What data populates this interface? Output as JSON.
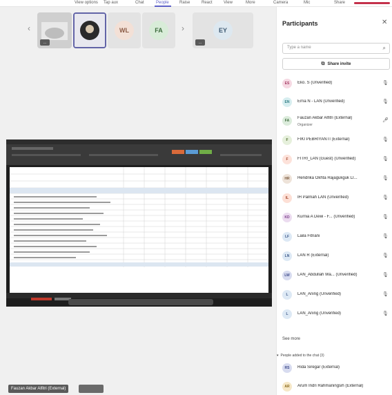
{
  "toolbar": {
    "items": [
      "View options",
      "Tap aux",
      "Chat",
      "People",
      "Raise",
      "React",
      "View",
      "More",
      "Camera",
      "Mic",
      "Share"
    ],
    "active_index": 3
  },
  "gallery": {
    "tiles": [
      {
        "initials": "",
        "type": "photo-room",
        "badge": "…"
      },
      {
        "initials": "",
        "type": "photo-face",
        "selected": true
      },
      {
        "initials": "WL",
        "color": "#f3e0d6",
        "text_color": "#8a5a44"
      },
      {
        "initials": "FA",
        "color": "#d8ecd8",
        "text_color": "#3d6b3d"
      },
      {
        "initials": "EY",
        "color": "#dde8f0",
        "text_color": "#3e5a73",
        "badge": "…"
      }
    ]
  },
  "stage": {
    "presenter_name": "Fauzan Akbar Alfitri (External)"
  },
  "panel": {
    "title": "Participants",
    "search_placeholder": "Type a name",
    "share_invite_label": "Share invite",
    "participants": [
      {
        "initials": "ES",
        "name": "Eko. S (Unverified)",
        "color": "#f6d9e3",
        "text_color": "#a33b63"
      },
      {
        "initials": "EN",
        "name": "Erna N - LAN (Unverified)",
        "color": "#d7eef0",
        "text_color": "#2d7a82"
      },
      {
        "initials": "FA",
        "name": "Fauzan Akbar Alfitri (External)",
        "role": "Organizer",
        "color": "#dcecdc",
        "text_color": "#3d6b3d",
        "mic_on": true
      },
      {
        "initials": "F",
        "name": "FIKI PEBRIYANTI (External)",
        "color": "#e6f0dc",
        "text_color": "#4f6b2d"
      },
      {
        "initials": "F",
        "name": "FITRI_LAN (Guest) (Unverified)",
        "color": "#fde2da",
        "text_color": "#a3462d"
      },
      {
        "initials": "HR",
        "name": "Hendrika Okhta Rajagukguk LI...",
        "color": "#eee3d9",
        "text_color": "#7a5a3d"
      },
      {
        "initials": "IL",
        "name": "IH Palmah LAN (Unverified)",
        "color": "#fde0d6",
        "text_color": "#a3462d"
      },
      {
        "initials": "KD",
        "name": "Kurnia A Dewi - F...  (Unverified)",
        "color": "#ecdcf0",
        "text_color": "#7a3d8a"
      },
      {
        "initials": "LF",
        "name": "Laila Fitriani",
        "color": "#dde9f5",
        "text_color": "#3e5a8a"
      },
      {
        "initials": "LN",
        "name": "LAN R (External)",
        "color": "#dde9f5",
        "text_color": "#3e5a8a"
      },
      {
        "initials": "LW",
        "name": "LAN_Abdullah Wa...  (Unverified)",
        "color": "#d8dcf0",
        "text_color": "#3d4a8a"
      },
      {
        "initials": "L",
        "name": "LAN_Aning (Unverified)",
        "color": "#dde9f5",
        "text_color": "#3e5a8a"
      },
      {
        "initials": "L",
        "name": "LAN_Aning (Unverified)",
        "color": "#dde9f5",
        "text_color": "#3e5a8a"
      }
    ],
    "see_more_label": "See more",
    "added_section_label": "People added to the chat (3)",
    "added_people": [
      {
        "initials": "RS",
        "name": "Rida Siregar (External)",
        "color": "#d8dcf0",
        "text_color": "#3d4a8a"
      },
      {
        "initials": "AR",
        "name": "Arum Indri Rahmaningsih (External)",
        "color": "#f6e8c8",
        "text_color": "#8a6a1d"
      }
    ]
  }
}
